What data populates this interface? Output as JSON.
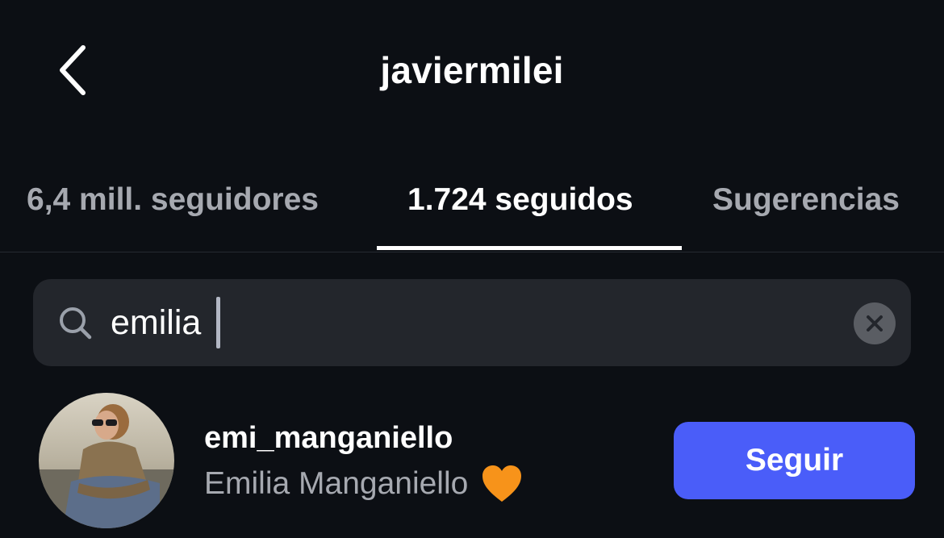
{
  "header": {
    "back_icon": "chevron-left-icon",
    "title": "javiermilei"
  },
  "tabs": [
    {
      "label": "6,4 mill. seguidores",
      "active": false
    },
    {
      "label": "1.724 seguidos",
      "active": true
    },
    {
      "label": "Sugerencias",
      "active": false
    }
  ],
  "search": {
    "icon": "search-icon",
    "value": "emilia",
    "clear_icon": "close-icon"
  },
  "results": [
    {
      "username": "emi_manganiello",
      "full_name": "Emilia Manganiello",
      "emoji": "orange-heart",
      "button_label": "Seguir"
    }
  ],
  "colors": {
    "background": "#0c0f14",
    "search_bg": "#23262c",
    "follow_button": "#4a5df9",
    "inactive_tab": "#a6a9b0",
    "heart": "#f7931a"
  }
}
